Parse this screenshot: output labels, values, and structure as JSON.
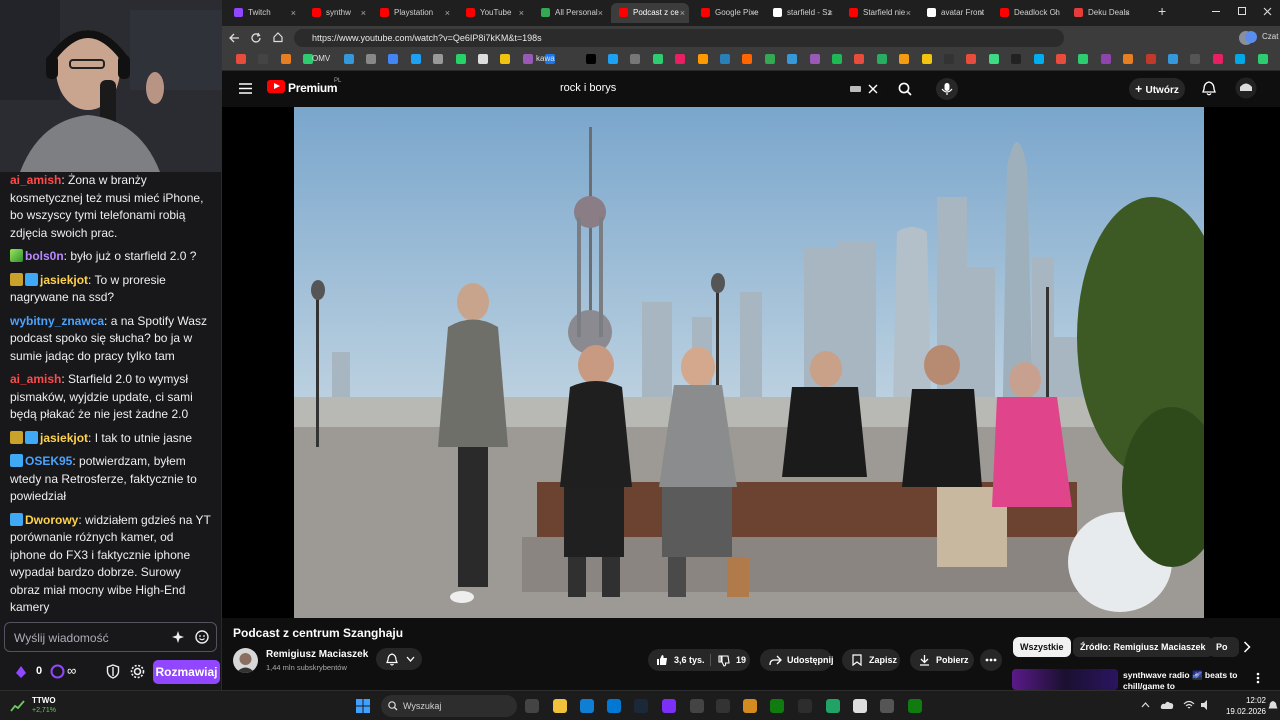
{
  "stream": {
    "chat_messages": [
      {
        "user": "ai_amish",
        "user_color": "#ff4a4a",
        "badges": [],
        "text": "Żona w branży kosmetycznej też musi mieć iPhone, bo wszyscy tymi telefonami robią zdjęcia swoich prac."
      },
      {
        "user": "bols0n",
        "user_color": "#b98aff",
        "badges": [
          "bits"
        ],
        "text": "było już o starfield 2.0 ?"
      },
      {
        "user": "jasiekjot",
        "user_color": "#ffd24a",
        "badges": [
          "rock",
          "sub"
        ],
        "text": "To w proresie nagrywane na ssd?"
      },
      {
        "user": "wybitny_znawca",
        "user_color": "#4aa3ff",
        "badges": [],
        "text": "a na Spotify Wasz podcast spoko się słucha? bo ja w sumie jadąc do pracy tylko tam"
      },
      {
        "user": "ai_amish",
        "user_color": "#ff4a4a",
        "badges": [],
        "text": "Starfield 2.0 to wymysł pismaków, wyjdzie update, ci sami będą płakać że nie jest żadne 2.0"
      },
      {
        "user": "jasiekjot",
        "user_color": "#ffd24a",
        "badges": [
          "rock",
          "sub"
        ],
        "text": "I tak to utnie jasne"
      },
      {
        "user": "OSEK95",
        "user_color": "#4aa3ff",
        "badges": [
          "sub"
        ],
        "text": "potwierdzam, byłem wtedy na Retrosferze, faktycznie to powiedział"
      },
      {
        "user": "Dworowy",
        "user_color": "#ffd24a",
        "badges": [
          "sub"
        ],
        "text": "widziałem gdzieś na YT porównanie różnych kamer, od iphone do FX3 i faktycznie iphone wypadał bardzo dobrze. Surowy obraz miał mocny wibe High-End kamery"
      }
    ],
    "chat_placeholder": "Wyślij wiadomość",
    "points": "0",
    "infinity": "∞",
    "chat_button": "Rozmawiaj"
  },
  "browser": {
    "tabs": [
      {
        "label": "Twitch",
        "color": "#9147ff"
      },
      {
        "label": "synthw",
        "color": "#ff0000"
      },
      {
        "label": "Playstation",
        "color": "#ff0000"
      },
      {
        "label": "YouTube",
        "color": "#ff0000"
      },
      {
        "label": "All Personal",
        "color": "#34a853"
      },
      {
        "label": "Podcast z ce",
        "color": "#ff0000"
      },
      {
        "label": "Google Pixe",
        "color": "#ff0000"
      },
      {
        "label": "starfield - Sz",
        "color": "#ffffff"
      },
      {
        "label": "Starfield nie",
        "color": "#ff0000"
      },
      {
        "label": "avatar Front",
        "color": "#ffffff"
      },
      {
        "label": "Deadlock Ch",
        "color": "#ff0000"
      },
      {
        "label": "Deku Deals",
        "color": "#e83b3b"
      }
    ],
    "new_tab": "+",
    "url": "https://www.youtube.com/watch?v=Qe6IP8i7kKM&t=198s",
    "bookmark_labels": [
      "OMV",
      "kawa"
    ],
    "profile_label": "Czat"
  },
  "youtube": {
    "brand": "Premium",
    "region": "PL",
    "search_query": "rock i borys",
    "create_label": "Utwórz",
    "video_title": "Podcast z centrum Szanghaju",
    "channel_name": "Remigiusz Maciaszek",
    "subscribers": "1,44 mln subskrybentów",
    "likes": "3,6 tys.",
    "dislikes": "19",
    "share": "Udostępnij",
    "save": "Zapisz",
    "download": "Pobierz",
    "chips": [
      "Wszystkie",
      "Źródło: Remigiusz Maciaszek",
      "Po"
    ],
    "rec_title": "synthwave radio 🌌 beats to chill/game to"
  },
  "taskbar": {
    "stock_name": "TTWO",
    "stock_change": "+2,71%",
    "search_placeholder": "Wyszukaj",
    "time": "12:02",
    "date": "19.02.2026"
  },
  "colors": {
    "accent_twitch": "#9147ff",
    "youtube_red": "#ff0000",
    "stock_green": "#6ccb5f"
  }
}
